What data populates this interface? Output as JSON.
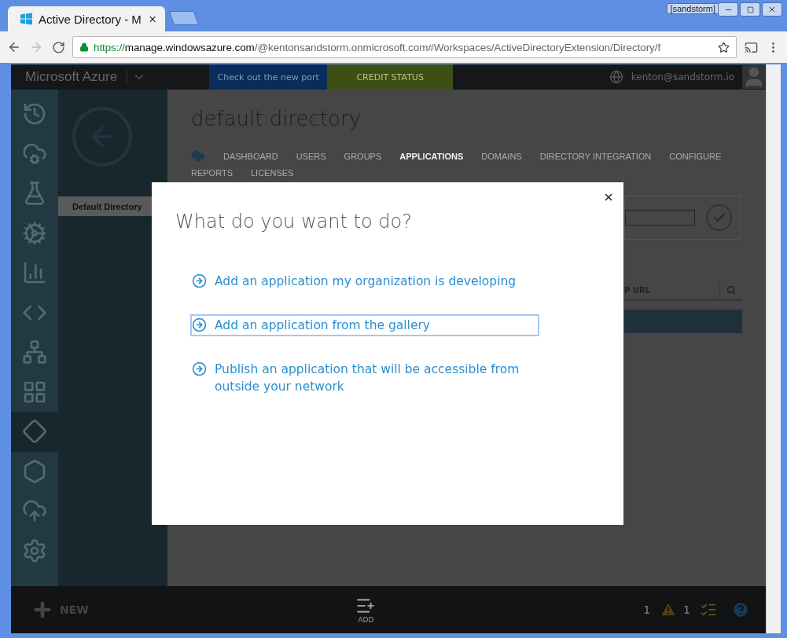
{
  "browser": {
    "tab_title": "Active Directory - M",
    "profile": "[sandstorm]",
    "url_scheme": "https://",
    "url_host": "manage.windowsazure.com",
    "url_rest": "/@kentonsandstorm.onmicrosoft.com#Workspaces/ActiveDirectoryExtension/Directory/f"
  },
  "topbar": {
    "brand": "Microsoft Azure",
    "promo": "Check out the new port",
    "credit": "CREDIT STATUS",
    "user": "kenton@sandstorm.io"
  },
  "rail": [
    {
      "kind": "clock",
      "selected": false
    },
    {
      "kind": "cloud",
      "selected": false
    },
    {
      "kind": "flask",
      "selected": false
    },
    {
      "kind": "gear",
      "selected": false
    },
    {
      "kind": "chart",
      "selected": false
    },
    {
      "kind": "code",
      "selected": false
    },
    {
      "kind": "network",
      "selected": false
    },
    {
      "kind": "grid",
      "selected": false
    },
    {
      "kind": "diamond",
      "selected": true
    },
    {
      "kind": "hexagon",
      "selected": false
    },
    {
      "kind": "upload",
      "selected": false
    },
    {
      "kind": "settings",
      "selected": false
    }
  ],
  "nav": {
    "items": [
      {
        "label": "Default Directory",
        "selected": true
      }
    ]
  },
  "page": {
    "title": "default directory",
    "tabs": [
      {
        "label": "DASHBOARD",
        "selected": false
      },
      {
        "label": "USERS",
        "selected": false
      },
      {
        "label": "GROUPS",
        "selected": false
      },
      {
        "label": "APPLICATIONS",
        "selected": true
      },
      {
        "label": "DOMAINS",
        "selected": false
      },
      {
        "label": "DIRECTORY INTEGRATION",
        "selected": false
      },
      {
        "label": "CONFIGURE",
        "selected": false
      },
      {
        "label": "REPORTS",
        "selected": false
      },
      {
        "label": "LICENSES",
        "selected": false
      }
    ],
    "table": {
      "columns": [
        "P URL"
      ]
    }
  },
  "dialog": {
    "title": "What do you want to do?",
    "options": [
      {
        "label": "Add an application my organization is developing",
        "selected": false
      },
      {
        "label": "Add an application from the gallery",
        "selected": true
      },
      {
        "label": "Publish an application that will be accessible from outside your network",
        "selected": false
      }
    ]
  },
  "bottombar": {
    "new": "NEW",
    "add": "ADD",
    "warnings": "1",
    "tasks": "1"
  }
}
